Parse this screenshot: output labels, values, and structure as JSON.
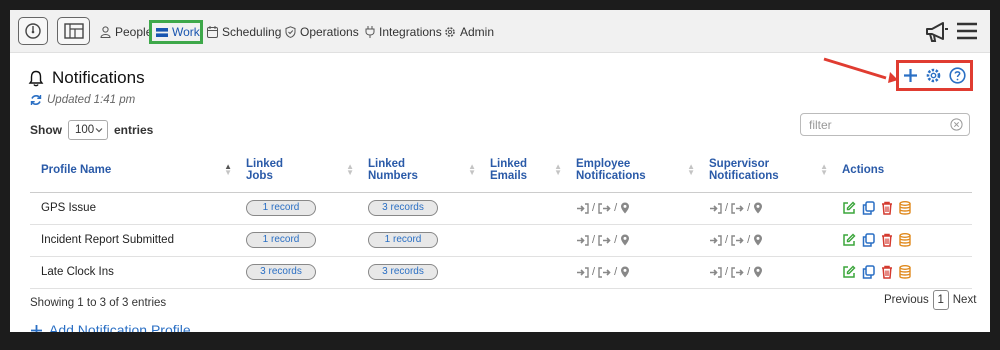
{
  "nav": {
    "items": [
      {
        "label": "People",
        "icon": "person-icon"
      },
      {
        "label": "Work",
        "icon": "work-icon"
      },
      {
        "label": "Scheduling",
        "icon": "calendar-icon"
      },
      {
        "label": "Operations",
        "icon": "shield-icon"
      },
      {
        "label": "Integrations",
        "icon": "plug-icon"
      },
      {
        "label": "Admin",
        "icon": "gear-icon"
      }
    ]
  },
  "header": {
    "title": "Notifications",
    "updated": "Updated 1:41 pm"
  },
  "controls": {
    "show_label": "Show",
    "entries_value": "100",
    "entries_label": "entries",
    "filter_placeholder": "filter"
  },
  "table": {
    "columns": [
      {
        "line1": "Profile Name",
        "line2": ""
      },
      {
        "line1": "Linked",
        "line2": "Jobs"
      },
      {
        "line1": "Linked",
        "line2": "Numbers"
      },
      {
        "line1": "Linked",
        "line2": "Emails"
      },
      {
        "line1": "Employee",
        "line2": "Notifications"
      },
      {
        "line1": "Supervisor",
        "line2": "Notifications"
      },
      {
        "line1": "Actions",
        "line2": ""
      }
    ],
    "rows": [
      {
        "name": "GPS Issue",
        "jobs": "1 record",
        "numbers": "3 records",
        "emails": ""
      },
      {
        "name": "Incident Report Submitted",
        "jobs": "1 record",
        "numbers": "1 record",
        "emails": ""
      },
      {
        "name": "Late Clock Ins",
        "jobs": "3 records",
        "numbers": "3 records",
        "emails": ""
      }
    ],
    "separator": "/"
  },
  "footer": {
    "info": "Showing 1 to 3 of 3 entries",
    "previous": "Previous",
    "page": "1",
    "next": "Next",
    "add_label": "Add Notification Profile"
  },
  "colors": {
    "accent": "#2a6fc4",
    "highlight_green": "#3ea84a",
    "highlight_red": "#e03c31",
    "edit": "#3aa53a",
    "copy": "#2a6fc4",
    "delete": "#d43a2f",
    "archive": "#e08a1e"
  }
}
